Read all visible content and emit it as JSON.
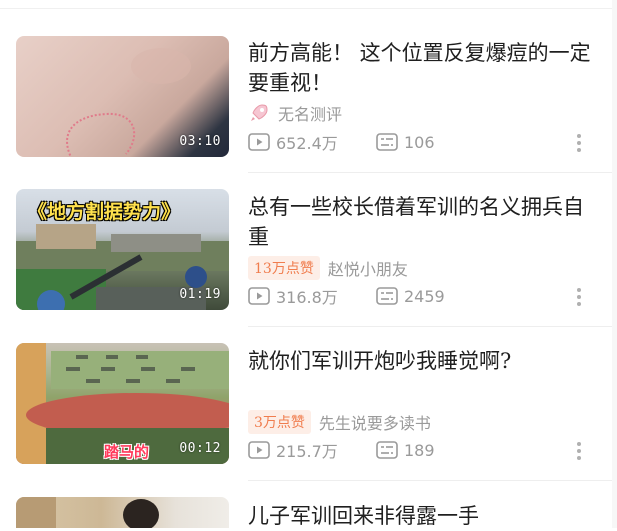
{
  "videos": [
    {
      "title": "前方高能！ 这个位置反复爆痘的一定要重视！",
      "author": "无名测评",
      "duration": "03:10",
      "views": "652.4万",
      "comments": "106",
      "has_avatar_icon": true
    },
    {
      "title": "总有一些校长借着军训的名义拥兵自重",
      "badge": "13万点赞",
      "author": "赵悦小朋友",
      "duration": "01:19",
      "views": "316.8万",
      "comments": "2459",
      "thumb_caption": "《地方割据势力》"
    },
    {
      "title": "就你们军训开炮吵我睡觉啊?",
      "badge": "3万点赞",
      "author": "先生说要多读书",
      "duration": "00:12",
      "views": "215.7万",
      "comments": "189",
      "thumb_caption": "踏马的"
    },
    {
      "title": "儿子军训回来非得露一手"
    }
  ],
  "colors": {
    "badge_text": "#f07d4e",
    "badge_bg": "#fdeee7",
    "meta": "#9a9a9a"
  }
}
